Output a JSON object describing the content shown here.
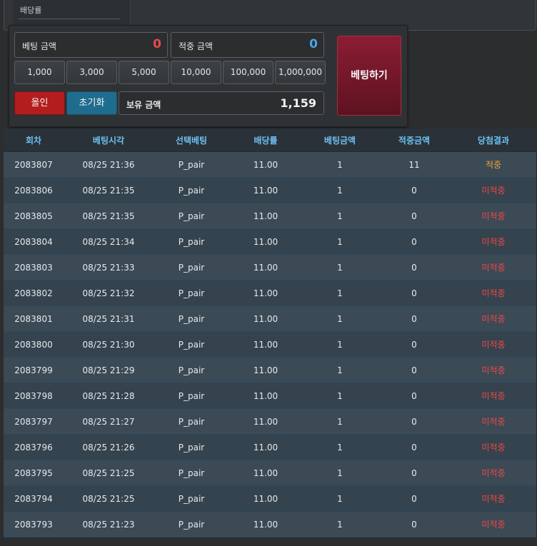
{
  "top": {
    "rate_label": "배당률"
  },
  "bet_panel": {
    "bet_amount_label": "베팅 금액",
    "bet_amount_value": "0",
    "win_amount_label": "적중 금액",
    "win_amount_value": "0",
    "chips": [
      "1,000",
      "3,000",
      "5,000",
      "10,000",
      "100,000",
      "1,000,000"
    ],
    "all_in_label": "올인",
    "reset_label": "초기화",
    "holding_label": "보유 금액",
    "holding_value": "1,159",
    "bet_button_label": "베팅하기",
    "colors": {
      "bet_amount": "#e84a4a",
      "win_amount": "#4aa3e8"
    }
  },
  "table": {
    "headers": [
      "회차",
      "베팅시각",
      "선택베팅",
      "배당률",
      "베팅금액",
      "적중금액",
      "당첨결과"
    ],
    "rows": [
      [
        "2083807",
        "08/25 21:36",
        "P_pair",
        "11.00",
        "1",
        "11",
        "적중"
      ],
      [
        "2083806",
        "08/25 21:35",
        "P_pair",
        "11.00",
        "1",
        "0",
        "미적중"
      ],
      [
        "2083805",
        "08/25 21:35",
        "P_pair",
        "11.00",
        "1",
        "0",
        "미적중"
      ],
      [
        "2083804",
        "08/25 21:34",
        "P_pair",
        "11.00",
        "1",
        "0",
        "미적중"
      ],
      [
        "2083803",
        "08/25 21:33",
        "P_pair",
        "11.00",
        "1",
        "0",
        "미적중"
      ],
      [
        "2083802",
        "08/25 21:32",
        "P_pair",
        "11.00",
        "1",
        "0",
        "미적중"
      ],
      [
        "2083801",
        "08/25 21:31",
        "P_pair",
        "11.00",
        "1",
        "0",
        "미적중"
      ],
      [
        "2083800",
        "08/25 21:30",
        "P_pair",
        "11.00",
        "1",
        "0",
        "미적중"
      ],
      [
        "2083799",
        "08/25 21:29",
        "P_pair",
        "11.00",
        "1",
        "0",
        "미적중"
      ],
      [
        "2083798",
        "08/25 21:28",
        "P_pair",
        "11.00",
        "1",
        "0",
        "미적중"
      ],
      [
        "2083797",
        "08/25 21:27",
        "P_pair",
        "11.00",
        "1",
        "0",
        "미적중"
      ],
      [
        "2083796",
        "08/25 21:26",
        "P_pair",
        "11.00",
        "1",
        "0",
        "미적중"
      ],
      [
        "2083795",
        "08/25 21:25",
        "P_pair",
        "11.00",
        "1",
        "0",
        "미적중"
      ],
      [
        "2083794",
        "08/25 21:25",
        "P_pair",
        "11.00",
        "1",
        "0",
        "미적중"
      ],
      [
        "2083793",
        "08/25 21:23",
        "P_pair",
        "11.00",
        "1",
        "0",
        "미적중"
      ]
    ]
  }
}
